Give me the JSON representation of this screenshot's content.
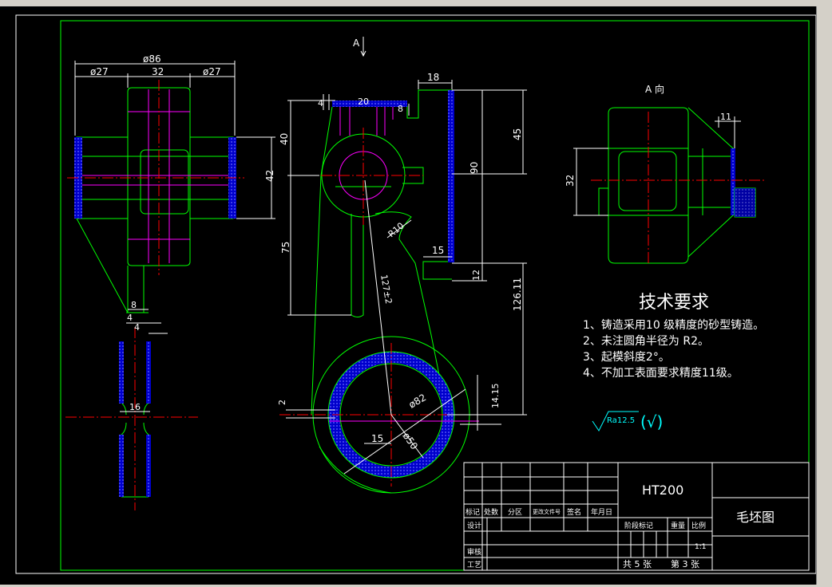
{
  "drawing": {
    "section_marker": "A",
    "view_label": "A 向",
    "dims": {
      "d86": "ø86",
      "d27a": "ø27",
      "d32": "32",
      "d27b": "ø27",
      "d42": "42",
      "d40": "40",
      "d8": "8",
      "d4a": "4",
      "d4b": "4",
      "d16": "16",
      "d4top": "4",
      "d20": "20",
      "d8top": "8",
      "d18": "18",
      "d45": "45",
      "d90": "90",
      "d75": "75",
      "d15a": "15",
      "d12": "12",
      "d126": "126.11",
      "dR10": "R10",
      "d127": "127±2",
      "d82": "ø82",
      "d50": "ø50",
      "d15b": "15",
      "d2": "2",
      "d1415": "14.15",
      "d11": "11",
      "d32b": "32"
    },
    "colors": {
      "outline": "#00ff00",
      "hidden": "#ff00ff",
      "center": "#ff0000",
      "dimension": "#ffffff",
      "hatch": "#0000ff",
      "hatch_dot": "#4040ff"
    }
  },
  "tech_requirements": {
    "title": "技术要求",
    "items": [
      "1、铸造采用10 级精度的砂型铸造。",
      "2、未注圆角半径为 R2。",
      "3、起模斜度2°。",
      "4、不加工表面要求精度11级。"
    ]
  },
  "roughness": {
    "symbol": "Ra12.5",
    "suffix": "(√)"
  },
  "title_block": {
    "material": "HT200",
    "drawing_name": "毛坯图",
    "row_labels": [
      "标记",
      "处数",
      "分区",
      "更改文件号",
      "签名",
      "年月日"
    ],
    "design": "设计",
    "review": "审核",
    "process": "工艺",
    "stage": "阶段标记",
    "weight": "重量",
    "scale_label": "比例",
    "scale": "1:1",
    "sheets_total": "共 5 张",
    "sheet_no": "第 3 张"
  }
}
